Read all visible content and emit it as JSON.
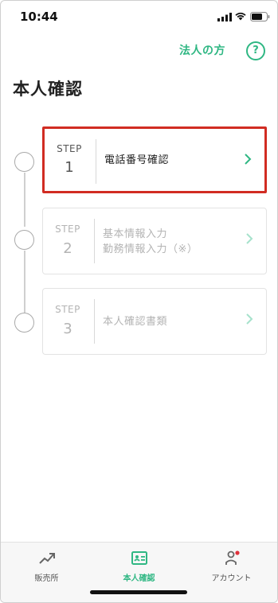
{
  "status_bar": {
    "time": "10:44"
  },
  "header": {
    "corporate_link": "法人の方",
    "help_icon": "?"
  },
  "page": {
    "title": "本人確認"
  },
  "steps": [
    {
      "label": "STEP",
      "number": "1",
      "lines": [
        "電話番号確認"
      ],
      "state": "active"
    },
    {
      "label": "STEP",
      "number": "2",
      "lines": [
        "基本情報入力",
        "勤務情報入力（※）"
      ],
      "state": "disabled"
    },
    {
      "label": "STEP",
      "number": "3",
      "lines": [
        "本人確認書類"
      ],
      "state": "disabled"
    }
  ],
  "tabbar": {
    "items": [
      {
        "label": "販売所",
        "icon": "trend-chart-icon",
        "active": false
      },
      {
        "label": "本人確認",
        "icon": "id-card-icon",
        "active": true
      },
      {
        "label": "アカウント",
        "icon": "person-icon",
        "active": false,
        "badge": true
      }
    ]
  },
  "colors": {
    "accent": "#2fb783",
    "highlight_border": "#d12c22",
    "badge": "#e0323c"
  }
}
